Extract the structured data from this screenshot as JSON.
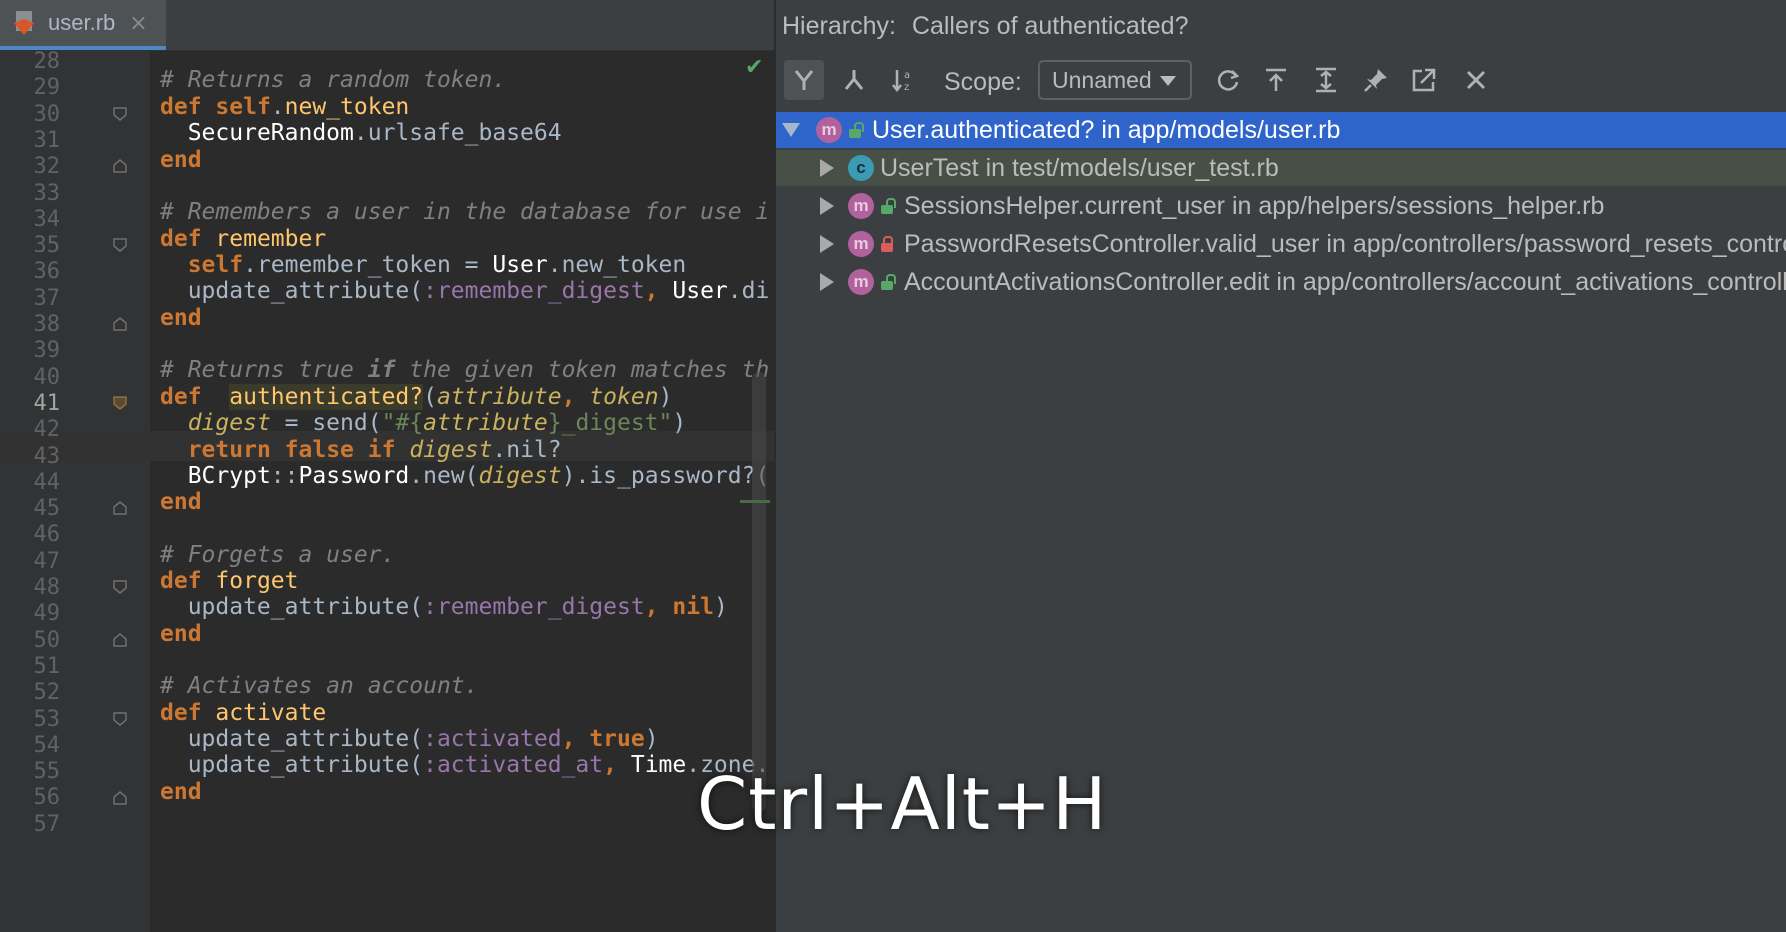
{
  "editor": {
    "tab": {
      "filename": "user.rb",
      "close": "×"
    },
    "line_numbers": [
      "28",
      "29",
      "30",
      "31",
      "32",
      "33",
      "34",
      "35",
      "36",
      "37",
      "38",
      "39",
      "40",
      "41",
      "42",
      "43",
      "44",
      "45",
      "46",
      "47",
      "48",
      "49",
      "50",
      "51",
      "52",
      "53",
      "54",
      "55",
      "56",
      "57"
    ],
    "current_line": "41",
    "status_icon": "check-icon"
  },
  "hierarchy": {
    "title_label": "Hierarchy:",
    "title_value": "Callers of authenticated?",
    "scope_label": "Scope:",
    "scope_value": "Unnamed",
    "toolbar_icons": [
      "caller-hierarchy-icon",
      "callee-hierarchy-icon",
      "sort-alphabetically-icon",
      "refresh-icon",
      "export-icon",
      "expand-all-icon",
      "pin-icon",
      "open-in-window-icon",
      "close-icon"
    ],
    "tree": [
      {
        "badge": "m",
        "text": "User.authenticated? in app/models/user.rb"
      },
      {
        "badge": "c",
        "text": "UserTest in test/models/user_test.rb"
      },
      {
        "badge": "m",
        "text": "SessionsHelper.current_user in app/helpers/sessions_helper.rb"
      },
      {
        "badge": "m",
        "text": "PasswordResetsController.valid_user in app/controllers/password_resets_controller.rb"
      },
      {
        "badge": "m",
        "text": "AccountActivationsController.edit in app/controllers/account_activations_controller.rb"
      }
    ]
  },
  "overlay": {
    "shortcut": "Ctrl+Alt+H"
  },
  "colors": {
    "selection": "#2f65ca",
    "keyword": "#cc7832",
    "comment": "#808080",
    "function": "#ffc66d"
  }
}
